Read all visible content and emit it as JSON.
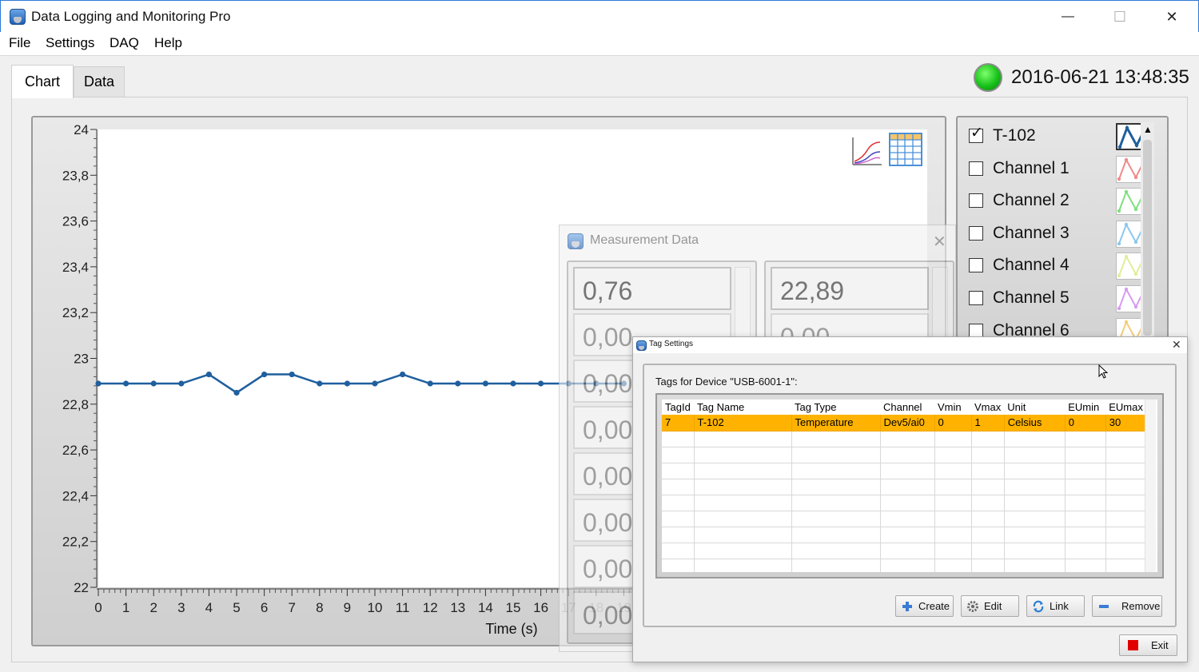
{
  "window": {
    "title": "Data Logging and Monitoring Pro",
    "minimize_glyph": "—",
    "maximize_glyph": "☐",
    "close_glyph": "✕"
  },
  "menu": {
    "items": [
      "File",
      "Settings",
      "DAQ",
      "Help"
    ]
  },
  "tabs": [
    {
      "label": "Chart",
      "active": true
    },
    {
      "label": "Data",
      "active": false
    }
  ],
  "status": {
    "datetime": "2016-06-21 13:48:35",
    "indicator_color": "#1ec41f"
  },
  "chart_data": {
    "type": "line",
    "xlabel": "Time (s)",
    "ylabel": "",
    "xlim": [
      0,
      30
    ],
    "ylim": [
      22,
      24
    ],
    "x_ticks": [
      "0",
      "1",
      "2",
      "3",
      "4",
      "5",
      "6",
      "7",
      "8",
      "9",
      "10",
      "11",
      "12",
      "13",
      "14",
      "15",
      "16",
      "17",
      "18",
      "19"
    ],
    "y_ticks": [
      "22",
      "22,2",
      "22,4",
      "22,6",
      "22,8",
      "23",
      "23,2",
      "23,4",
      "23,6",
      "23,8",
      "24"
    ],
    "series": [
      {
        "name": "T-102",
        "color": "#1f5f9e",
        "x": [
          0,
          1,
          2,
          3,
          4,
          5,
          6,
          7,
          8,
          9,
          10,
          11,
          12,
          13,
          14,
          15,
          16,
          17,
          18,
          19
        ],
        "y": [
          22.89,
          22.89,
          22.89,
          22.89,
          22.93,
          22.85,
          22.93,
          22.93,
          22.89,
          22.89,
          22.89,
          22.93,
          22.89,
          22.89,
          22.89,
          22.89,
          22.89,
          22.89,
          22.89,
          22.89
        ]
      }
    ],
    "grid": false
  },
  "legend": {
    "channels": [
      {
        "label": "T-102",
        "checked": true,
        "color": "#1f5f9e",
        "check_glyph": "✓"
      },
      {
        "label": "Channel 1",
        "checked": false,
        "color": "#f08a8a"
      },
      {
        "label": "Channel 2",
        "checked": false,
        "color": "#7ee07e"
      },
      {
        "label": "Channel 3",
        "checked": false,
        "color": "#8cc8ee"
      },
      {
        "label": "Channel 4",
        "checked": false,
        "color": "#e0ee9a"
      },
      {
        "label": "Channel 5",
        "checked": false,
        "color": "#d69af0"
      },
      {
        "label": "Channel 6",
        "checked": false,
        "color": "#f6cc7a"
      }
    ],
    "scroll_up_glyph": "▲"
  },
  "measurement_window": {
    "title": "Measurement Data",
    "close_glyph": "✕",
    "col1": [
      "0,76",
      "0,00",
      "0,00",
      "0,00",
      "0,00",
      "0,00",
      "0,00",
      "0,00"
    ],
    "col2": [
      "22,89",
      "0,00"
    ]
  },
  "tag_window": {
    "title": "Tag Settings",
    "close_glyph": "✕",
    "group_label": "Tags for Device \"USB-6001-1\":",
    "columns": [
      "TagId",
      "Tag Name",
      "Tag Type",
      "Channel",
      "Vmin",
      "Vmax",
      "Unit",
      "EUmin",
      "EUmax"
    ],
    "rows": [
      [
        "7",
        "T-102",
        "Temperature",
        "Dev5/ai0",
        "0",
        "1",
        "Celsius",
        "0",
        "30"
      ]
    ],
    "empty_rows": 9,
    "selection_color": "#ffb300",
    "buttons": {
      "create": "Create",
      "edit": "Edit",
      "link": "Link",
      "remove": "Remove",
      "exit": "Exit"
    }
  }
}
